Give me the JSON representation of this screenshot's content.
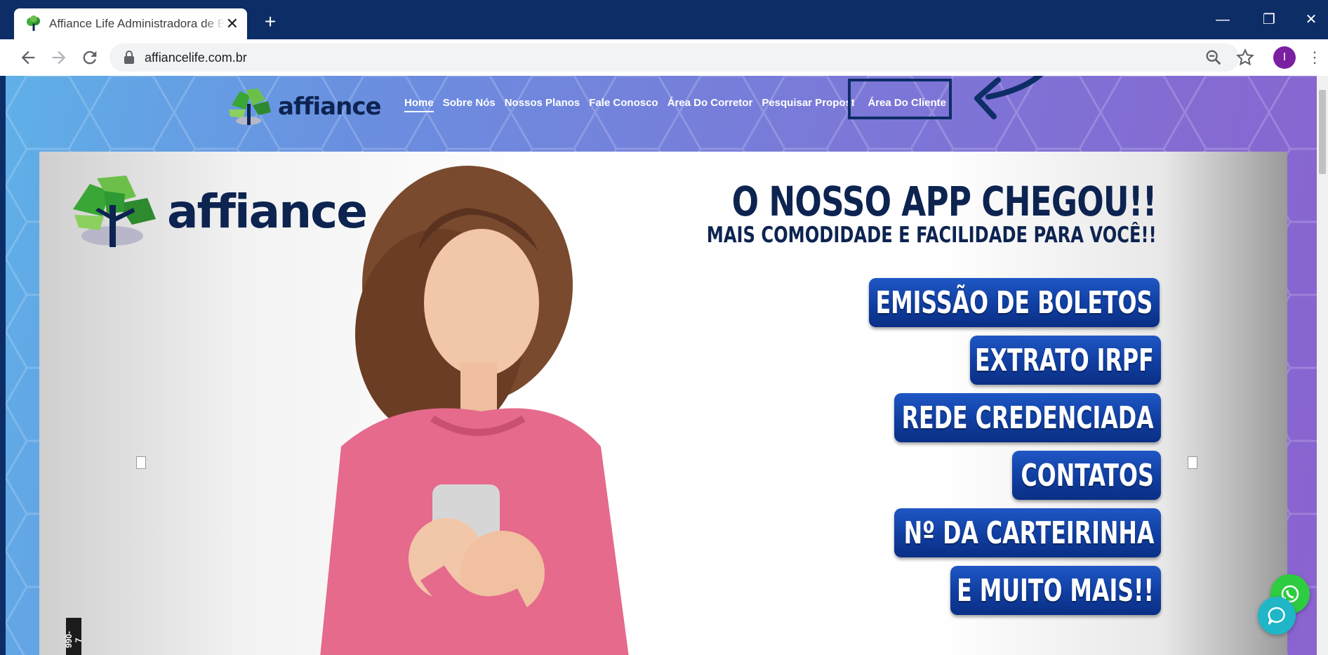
{
  "browser": {
    "tab_title": "Affiance Life Administradora de Benefícios",
    "new_tab_label": "+",
    "url": "affiancelife.com.br",
    "profile_initial": "I",
    "window_controls": {
      "minimize": "—",
      "restore": "❐",
      "close": "✕"
    },
    "icons": [
      "back-icon",
      "forward-icon",
      "reload-icon",
      "lock-icon",
      "zoom-icon",
      "star-icon",
      "menu-icon"
    ]
  },
  "site": {
    "logo_text": "affiance",
    "nav": [
      {
        "label": "Home",
        "active": true
      },
      {
        "label": "Sobre Nós"
      },
      {
        "label": "Nossos Planos"
      },
      {
        "label": "Fale Conosco"
      },
      {
        "label": "Área Do Corretor"
      },
      {
        "label": "Pesquisar Proposta"
      },
      {
        "label": "Área Do Cliente",
        "highlighted": true
      }
    ],
    "highlight_color": "#0d2d66"
  },
  "banner": {
    "logo_text": "affiance",
    "headline": "O NOSSO APP CHEGOU!!",
    "subheadline": "MAIS COMODIDADE E FACILIDADE PARA VOCÊ!!",
    "features": [
      "EMISSÃO DE BOLETOS",
      "EXTRATO IRPF",
      "REDE CREDENCIADA",
      "CONTATOS",
      "Nº DA CARTEIRINHA",
      "E MUITO MAIS!!"
    ],
    "reg_number": "990-7",
    "accent_color": "#0d2451",
    "pill_color": "#1f57c5"
  },
  "floating": {
    "whatsapp_icon": "whatsapp-icon",
    "chat_icon": "chat-icon"
  }
}
